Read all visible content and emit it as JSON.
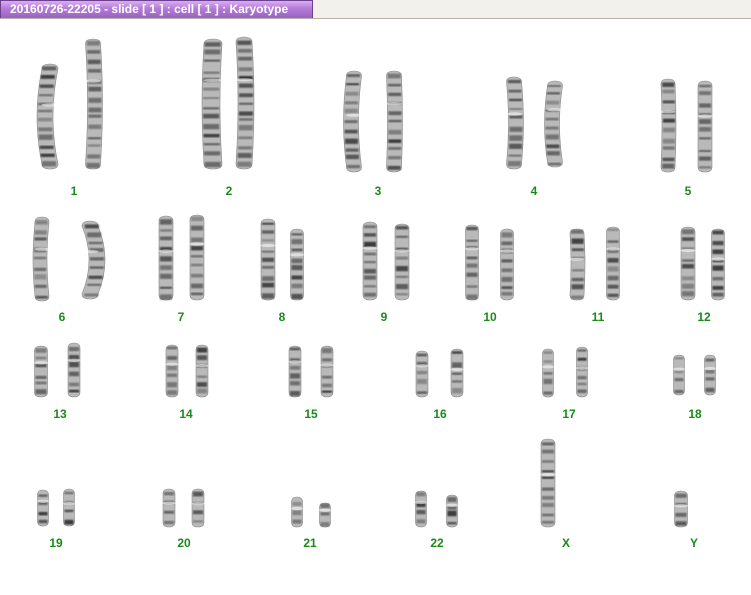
{
  "window": {
    "title": "20160726-22205 - slide [ 1 ] : cell [ 1 ] : Karyotype"
  },
  "colors": {
    "label": "#1a8a1a",
    "tab": "#b27cd6"
  },
  "karyotype": [
    {
      "label": "1"
    },
    {
      "label": "2"
    },
    {
      "label": "3"
    },
    {
      "label": "4"
    },
    {
      "label": "5"
    },
    {
      "label": "6"
    },
    {
      "label": "7"
    },
    {
      "label": "8"
    },
    {
      "label": "9"
    },
    {
      "label": "10"
    },
    {
      "label": "11"
    },
    {
      "label": "12"
    },
    {
      "label": "13"
    },
    {
      "label": "14"
    },
    {
      "label": "15"
    },
    {
      "label": "16"
    },
    {
      "label": "17"
    },
    {
      "label": "18"
    },
    {
      "label": "19"
    },
    {
      "label": "20"
    },
    {
      "label": "21"
    },
    {
      "label": "22"
    },
    {
      "label": "X"
    },
    {
      "label": "Y"
    }
  ]
}
